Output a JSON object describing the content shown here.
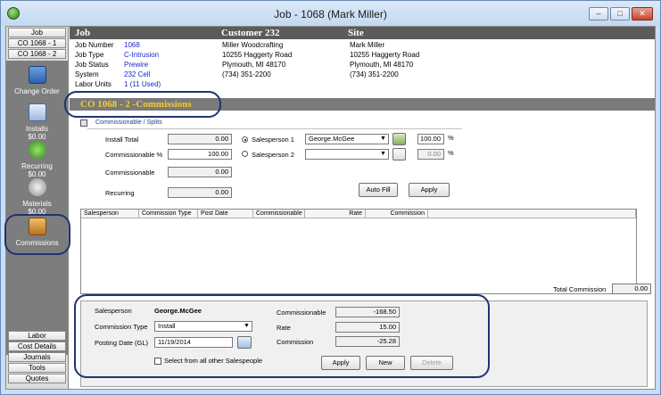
{
  "window": {
    "title": "Job - 1068 (Mark Miller)"
  },
  "sidebar": {
    "top_tabs": [
      "Job",
      "CO 1068 - 1",
      "CO 1068 - 2"
    ],
    "icons": [
      {
        "label": "Change Order",
        "icon": "change-order-icon"
      },
      {
        "label": "Installs",
        "sub": "$0.00",
        "icon": "installs-icon"
      },
      {
        "label": "Recurring",
        "sub": "$0.00",
        "icon": "recurring-icon"
      },
      {
        "label": "Materials",
        "sub": "$0.00",
        "icon": "materials-icon"
      },
      {
        "label": "Commissions",
        "icon": "commissions-icon"
      }
    ],
    "bottom_tabs": [
      "Labor",
      "Cost Details",
      "Journals",
      "Tools",
      "Quotes"
    ]
  },
  "header": {
    "job": "Job",
    "customer": "Customer 232",
    "site": "Site"
  },
  "job_info": {
    "rows": [
      {
        "k": "Job Number",
        "v": "1068"
      },
      {
        "k": "Job Type",
        "v": "C-Intrusion"
      },
      {
        "k": "Job Status",
        "v": "Prewire"
      },
      {
        "k": "System",
        "v": "232 Cell"
      },
      {
        "k": "Labor Units",
        "v": "1 (11 Used)"
      }
    ]
  },
  "customer": {
    "lines": [
      "Miller Woodcrafting",
      "10255 Haggerty Road",
      "Plymouth, MI 48170",
      "(734) 351-2200"
    ]
  },
  "site": {
    "lines": [
      "Mark Miller",
      "10255 Haggerty Road",
      "Plymouth, MI 48170",
      "(734) 351-2200"
    ]
  },
  "section": {
    "title": "CO 1068 - 2 -Commissions",
    "tab": "Commissionable / Splits"
  },
  "form": {
    "install_total_label": "Install Total",
    "install_total": "0.00",
    "commissionable_pct_label": "Commissionable %",
    "commissionable_pct": "100.00",
    "commissionable_label": "Commissionable",
    "commissionable": "0.00",
    "recurring_label": "Recurring",
    "recurring": "0.00",
    "salesperson1_label": "Salesperson 1",
    "salesperson1": "George.McGee",
    "pct1": "100.00",
    "salesperson2_label": "Salesperson 2",
    "salesperson2": "",
    "pct2": "0.00",
    "pct_sign": "%",
    "autofill": "Auto Fill",
    "apply": "Apply"
  },
  "grid": {
    "columns": [
      "Salesperson",
      "Commission Type",
      "Post Date",
      "Commissionable",
      "Rate",
      "Commission"
    ]
  },
  "total": {
    "label": "Total Commission",
    "value": "0.00"
  },
  "detail": {
    "salesperson_label": "Salesperson",
    "salesperson": "George.McGee",
    "type_label": "Commission Type",
    "type": "Install",
    "date_label": "Posting Date (GL)",
    "date": "11/19/2014",
    "select_all": "Select from all other Salespeople",
    "commissionable_label": "Commissionable",
    "commissionable": "-168.50",
    "rate_label": "Rate",
    "rate": "15.00",
    "commission_label": "Commission",
    "commission": "-25.28",
    "apply": "Apply",
    "new": "New",
    "delete": "Delete"
  }
}
